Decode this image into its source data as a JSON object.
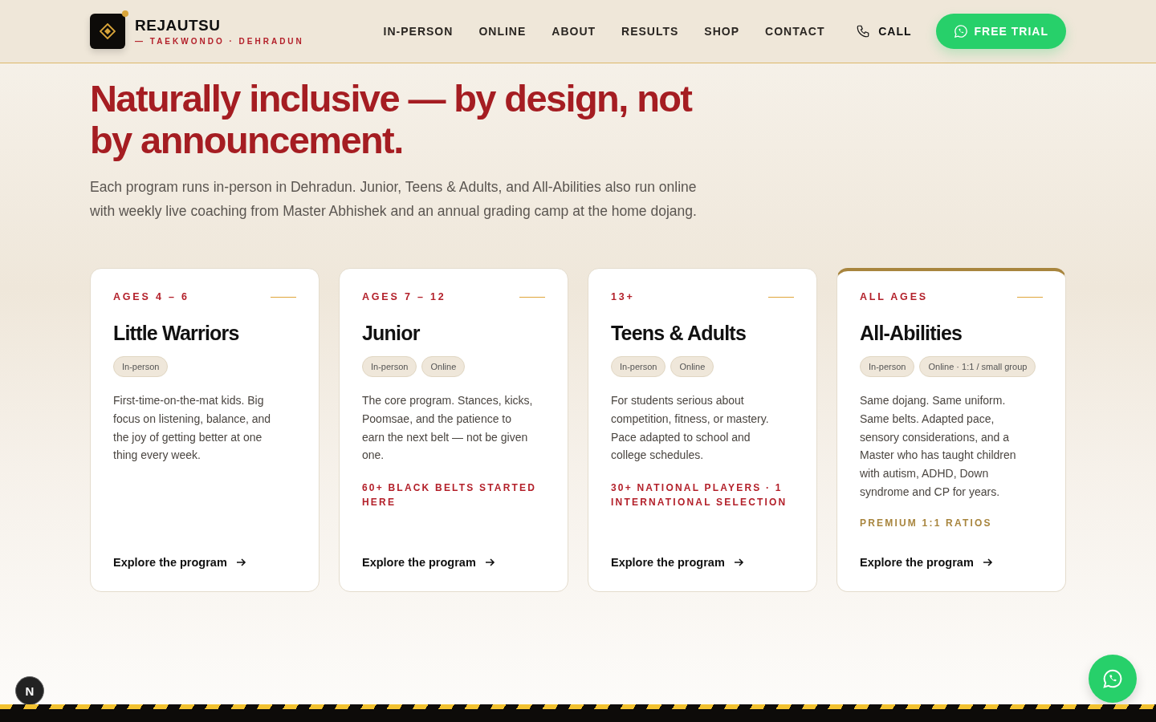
{
  "header": {
    "brand": "REJAUTSU",
    "tagline": "— TAEKWONDO · DEHRADUN",
    "nav": [
      {
        "label": "IN-PERSON"
      },
      {
        "label": "ONLINE"
      },
      {
        "label": "ABOUT"
      },
      {
        "label": "RESULTS"
      },
      {
        "label": "SHOP"
      },
      {
        "label": "CONTACT"
      }
    ],
    "call": "CALL",
    "cta": "FREE TRIAL"
  },
  "hero": {
    "headline": "Naturally inclusive — by design, not by announcement.",
    "intro": "Each program runs in-person in Dehradun. Junior, Teens & Adults, and All-Abilities also run online with weekly live coaching from Master Abhishek and an annual grading camp at the home dojang."
  },
  "programs": [
    {
      "eyebrow": "AGES 4 – 6",
      "title": "Little Warriors",
      "tags": [
        "In-person"
      ],
      "description": "First-time-on-the-mat kids. Big focus on listening, balance, and the joy of getting better at one thing every week.",
      "link": "Explore the program",
      "featured": false
    },
    {
      "eyebrow": "AGES 7 – 12",
      "title": "Junior",
      "tags": [
        "In-person",
        "Online"
      ],
      "description": "The core program. Stances, kicks, Poomsae, and the patience to earn the next belt — not be given one.",
      "note": "60+ BLACK BELTS STARTED HERE",
      "link": "Explore the program",
      "featured": false
    },
    {
      "eyebrow": "13+",
      "title": "Teens & Adults",
      "tags": [
        "In-person",
        "Online"
      ],
      "description": "For students serious about competition, fitness, or mastery. Pace adapted to school and college schedules.",
      "note": "30+ NATIONAL PLAYERS · 1 INTERNATIONAL SELECTION",
      "link": "Explore the program",
      "featured": false
    },
    {
      "eyebrow": "ALL AGES",
      "title": "All-Abilities",
      "tags": [
        "In-person",
        "Online · 1:1 / small group"
      ],
      "description": "Same dojang. Same uniform. Same belts. Adapted pace, sensory considerations, and a Master who has taught children with autism, ADHD, Down syndrome and CP for years.",
      "note": "PREMIUM 1:1 RATIOS",
      "link": "Explore the program",
      "featured": true
    }
  ],
  "dev_badge": "N"
}
